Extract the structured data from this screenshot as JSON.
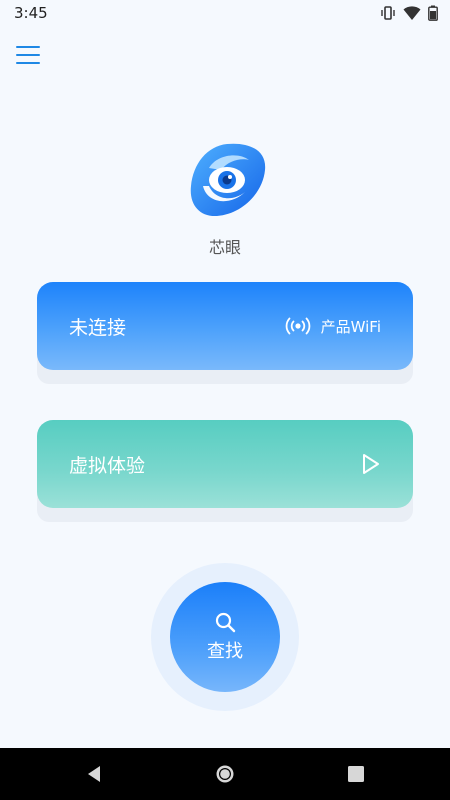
{
  "status_bar": {
    "time": "3:45",
    "icons": [
      "vibrate-icon",
      "wifi-icon",
      "battery-icon"
    ]
  },
  "header": {
    "menu_icon": "menu-icon"
  },
  "app": {
    "name": "芯眼",
    "logo_icon": "camera-eye-logo"
  },
  "cards": {
    "connect": {
      "title": "未连接",
      "right_label": "产品WiFi",
      "icon": "wifi-broadcast-icon",
      "color": "#1d83fb"
    },
    "demo": {
      "title": "虚拟体验",
      "icon": "play-icon",
      "color": "#57cdc1"
    }
  },
  "search": {
    "label": "查找",
    "icon": "search-icon"
  },
  "nav_bar": {
    "icons": [
      "back-icon",
      "home-icon",
      "recents-icon"
    ]
  }
}
